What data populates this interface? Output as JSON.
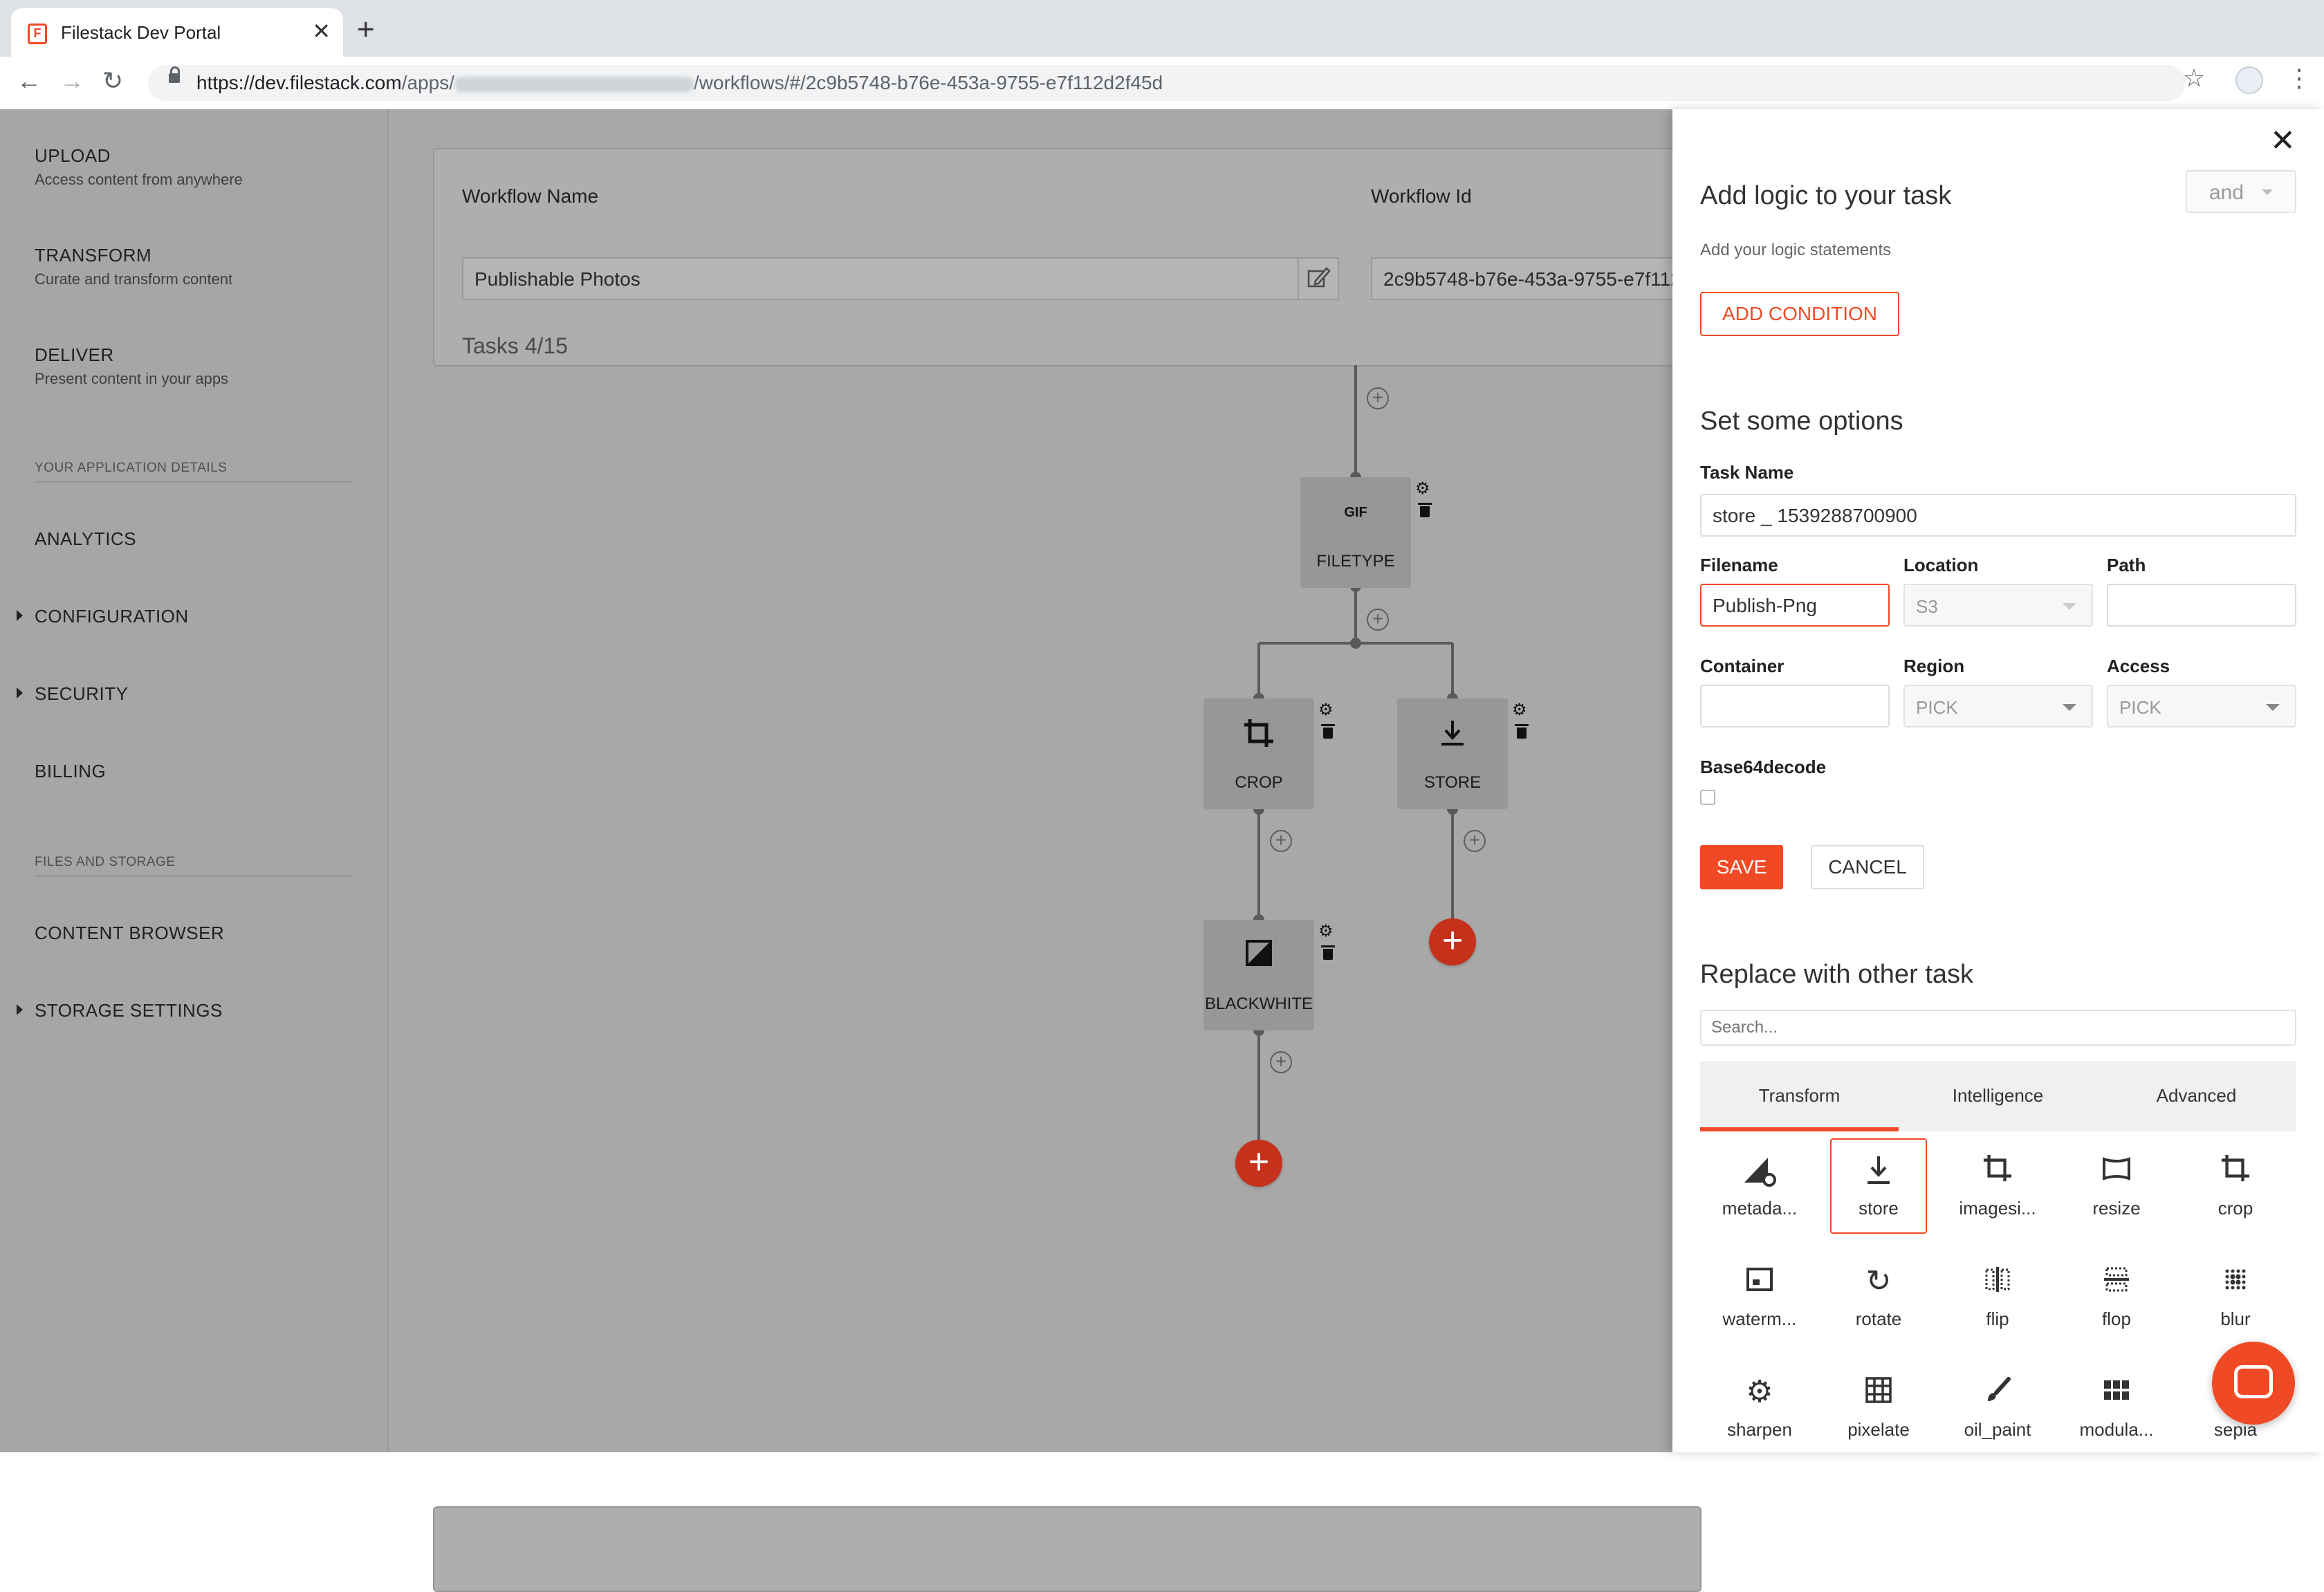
{
  "browser": {
    "tab_title": "Filestack Dev Portal",
    "url_host": "https://dev.filestack.com",
    "url_path_1": "/apps/",
    "url_path_2": "/workflows/#/2c9b5748-b76e-453a-9755-e7f112d2f45d"
  },
  "sidebar": {
    "items": [
      {
        "label": "UPLOAD",
        "sub": "Access content from anywhere"
      },
      {
        "label": "TRANSFORM",
        "sub": "Curate and transform content"
      },
      {
        "label": "DELIVER",
        "sub": "Present content in your apps"
      }
    ],
    "section1": "YOUR APPLICATION DETAILS",
    "analytics": "ANALYTICS",
    "configuration": "CONFIGURATION",
    "security": "SECURITY",
    "billing": "BILLING",
    "section2": "FILES AND STORAGE",
    "content_browser": "CONTENT BROWSER",
    "storage_settings": "STORAGE SETTINGS"
  },
  "workflow": {
    "name_label": "Workflow Name",
    "name_value": "Publishable Photos",
    "id_label": "Workflow Id",
    "id_value": "2c9b5748-b76e-453a-9755-e7f112d2f45d",
    "tasks": "Tasks 4/15",
    "nodes": {
      "filetype": {
        "label": "FILETYPE",
        "icon": "gif-icon",
        "glyph": "GIF"
      },
      "crop": {
        "label": "CROP",
        "icon": "crop-icon"
      },
      "store": {
        "label": "STORE",
        "icon": "download-icon"
      },
      "blackwhite": {
        "label": "BLACKWHITE",
        "icon": "contrast-icon"
      }
    }
  },
  "panel": {
    "logic_title": "Add logic to your task",
    "logic_operator": "and",
    "logic_sub": "Add your logic statements",
    "add_condition": "ADD CONDITION",
    "options_title": "Set some options",
    "task_name_label": "Task Name",
    "task_name_value": "store _ 1539288700900",
    "filename_label": "Filename",
    "filename_value": "Publish-Png",
    "location_label": "Location",
    "location_value": "S3",
    "path_label": "Path",
    "path_value": "",
    "container_label": "Container",
    "container_value": "",
    "region_label": "Region",
    "region_value": "PICK",
    "access_label": "Access",
    "access_value": "PICK",
    "base64_label": "Base64decode",
    "base64_checked": false,
    "save": "SAVE",
    "cancel": "CANCEL",
    "replace_title": "Replace with other task",
    "search_placeholder": "Search...",
    "tabs": [
      "Transform",
      "Intelligence",
      "Advanced"
    ],
    "active_tab": "Transform",
    "tasks": [
      {
        "label": "metada...",
        "icon": "metadata-icon"
      },
      {
        "label": "store",
        "icon": "store-icon",
        "selected": true
      },
      {
        "label": "imagesi...",
        "icon": "imagesize-icon"
      },
      {
        "label": "resize",
        "icon": "resize-icon"
      },
      {
        "label": "crop",
        "icon": "crop-icon"
      },
      {
        "label": "waterm...",
        "icon": "watermark-icon"
      },
      {
        "label": "rotate",
        "icon": "rotate-icon"
      },
      {
        "label": "flip",
        "icon": "flip-icon"
      },
      {
        "label": "flop",
        "icon": "flop-icon"
      },
      {
        "label": "blur",
        "icon": "blur-icon"
      },
      {
        "label": "sharpen",
        "icon": "sharpen-icon"
      },
      {
        "label": "pixelate",
        "icon": "pixelate-icon"
      },
      {
        "label": "oil_paint",
        "icon": "oil-paint-icon"
      },
      {
        "label": "modula...",
        "icon": "modulate-icon"
      },
      {
        "label": "sepia",
        "icon": "sepia-icon"
      }
    ]
  },
  "colors": {
    "accent": "#ef4a25",
    "add_node": "#c6311c",
    "overlay": "#a8a8a8"
  }
}
